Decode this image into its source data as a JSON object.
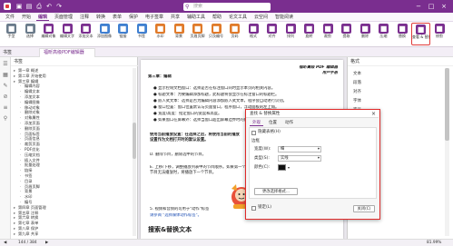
{
  "titlebar": {
    "search_placeholder": "搜索",
    "window_controls": [
      "minimize-icon",
      "maximize-icon",
      "close-icon"
    ]
  },
  "menubar": {
    "items": [
      "文件",
      "开始",
      "编辑",
      "页面管理",
      "注释",
      "转换",
      "表单",
      "保护",
      "电子签章",
      "共享",
      "辅助工具",
      "帮助",
      "论文工具",
      "云空间",
      "智能阅读"
    ],
    "active": "编辑"
  },
  "ribbon": {
    "buttons": [
      {
        "label": "手型",
        "icon": "hand-icon",
        "color": "#6a7a8a"
      },
      {
        "label": "选择",
        "icon": "cursor-icon",
        "color": "#6a7a8a"
      },
      {
        "label": "编辑对象",
        "icon": "edit-object-icon",
        "color": "#7a2e8f"
      },
      {
        "label": "编辑文字",
        "icon": "edit-text-icon",
        "color": "#7a2e8f"
      },
      {
        "label": "添加文本",
        "icon": "add-text-icon",
        "color": "#7a2e8f"
      },
      {
        "label": "添加图像",
        "icon": "add-image-icon",
        "color": "#3f7fd0"
      },
      {
        "label": "链接",
        "icon": "link-icon",
        "color": "#3f7fd0"
      },
      {
        "label": "书签",
        "icon": "bookmark-icon",
        "color": "#3f7fd0"
      },
      {
        "label": "水印",
        "icon": "watermark-icon",
        "color": "#e07a2a"
      },
      {
        "label": "背景",
        "icon": "background-icon",
        "color": "#e07a2a"
      },
      {
        "label": "页眉页脚",
        "icon": "header-footer-icon",
        "color": "#e07a2a"
      },
      {
        "label": "贝茨编号",
        "icon": "bates-icon",
        "color": "#e07a2a"
      },
      {
        "label": "页码",
        "icon": "page-number-icon",
        "color": "#e07a2a"
      },
      {
        "label": "格式",
        "icon": "format-icon",
        "color": "#7a2e8f"
      },
      {
        "label": "对齐",
        "icon": "align-icon",
        "color": "#7a2e8f"
      },
      {
        "label": "排列",
        "icon": "arrange-icon",
        "color": "#7a2e8f"
      },
      {
        "label": "旋转",
        "icon": "rotate-icon",
        "color": "#7a2e8f"
      },
      {
        "label": "裁剪",
        "icon": "crop-icon",
        "color": "#7a2e8f"
      },
      {
        "label": "提取",
        "icon": "extract-icon",
        "color": "#7a2e8f"
      },
      {
        "label": "删除",
        "icon": "delete-icon",
        "color": "#7a2e8f"
      },
      {
        "label": "压缩",
        "icon": "compress-icon",
        "color": "#7a2e8f"
      },
      {
        "label": "替换",
        "icon": "replace-icon",
        "color": "#7a2e8f"
      },
      {
        "label": "查看 & 替换",
        "icon": "view-replace-icon",
        "color": "#7a2e8f"
      },
      {
        "label": "修剪",
        "icon": "trim-icon",
        "color": "#7a2e8f"
      }
    ]
  },
  "tabs": {
    "outline_head": "书签",
    "doc_tab": "福昕高级PDF编辑器"
  },
  "outline": {
    "items": [
      "第一章 概述",
      "第二章 开始使用",
      "第三章 编辑",
      "编辑内容",
      "编辑文本",
      "添加文本",
      "编辑图像",
      "移动对象",
      "删除对象",
      "对象属性",
      "添加页面",
      "删除页面",
      "页面标签",
      "页面信息",
      "裁剪页面",
      "PDF优化",
      "压缩文档",
      "插入文件",
      "批量处理",
      "链接",
      "书签",
      "目录",
      "页眉页脚",
      "背景",
      "水印",
      "编号",
      "第四章 页面管理",
      "第五章 注释",
      "第六章 转换",
      "第七章 表单",
      "第八章 保护",
      "第九章 共享"
    ]
  },
  "page": {
    "header_right": "福昕高级 PDF 编辑器",
    "header_right2": "用户手册",
    "chapter": "第三章：编辑",
    "lines": [
      "● 显示控制文档窗口：选择是否在标注窗口同时显示本页的相关内容。",
      "● 标题文本：为要编辑添加标题，此标题将会显示在标注窗口的标题栏。",
      "● 嵌入式文本：选择是否为编辑内容添加嵌入式文本，程序会自动进行识别。",
      "● 窗口位置：窗口位置默认与页面窗口，程序窗口，浮动面板的左上角。",
      "● 宽度/高度：指定窗口的宽度和高度。",
      "● 如果窗口在屏幕外：选择当窗口超出屏幕边界时的处理方式。"
    ],
    "para1": "使用当前播放设置：在选择之后，将使用当前的播放设置作为文档打开时的默认设置。",
    "para2": "D. 删除节目，删除选中的节目。",
    "para3": "E. 上移/下移，调整播放列表中的节目顺序。如果第一个节目无法播放时，将播放下一个节目。",
    "para4": "5. 视频和音频的可用于\"动作\"标签",
    "para5": "请参阅 \"选择媒体动作标签\"。",
    "section_title": "搜索&替换文本",
    "section_body": "您可以通过\"搜索&替换\"功能快速搜索文档中出现的文本，或对其进行编辑。",
    "footer": "福昕高级PDF编辑器提供了搜索和替换功能。"
  },
  "rightpanel": {
    "head": "格式",
    "items": [
      "文本",
      "段落",
      "对齐",
      "字体",
      "字号",
      "行距",
      "颜色"
    ]
  },
  "dialog": {
    "title": "查找 & 替换属性",
    "tabs": [
      "外观",
      "位置",
      "动作"
    ],
    "active_tab": "外观",
    "checkbox_label": "隐藏表格(H)",
    "group_label": "边框",
    "rows": [
      {
        "label": "宽度(W):",
        "value": "细"
      },
      {
        "label": "类型(S):",
        "value": "实线"
      },
      {
        "label": "颜色(C):",
        "value": ""
      }
    ],
    "mid_button": "更改选择格式...",
    "locked_label": "锁定(L)",
    "close_button": "关闭(C)"
  },
  "statusbar": {
    "page_info": "144 / 384",
    "zoom": "81.99%"
  }
}
